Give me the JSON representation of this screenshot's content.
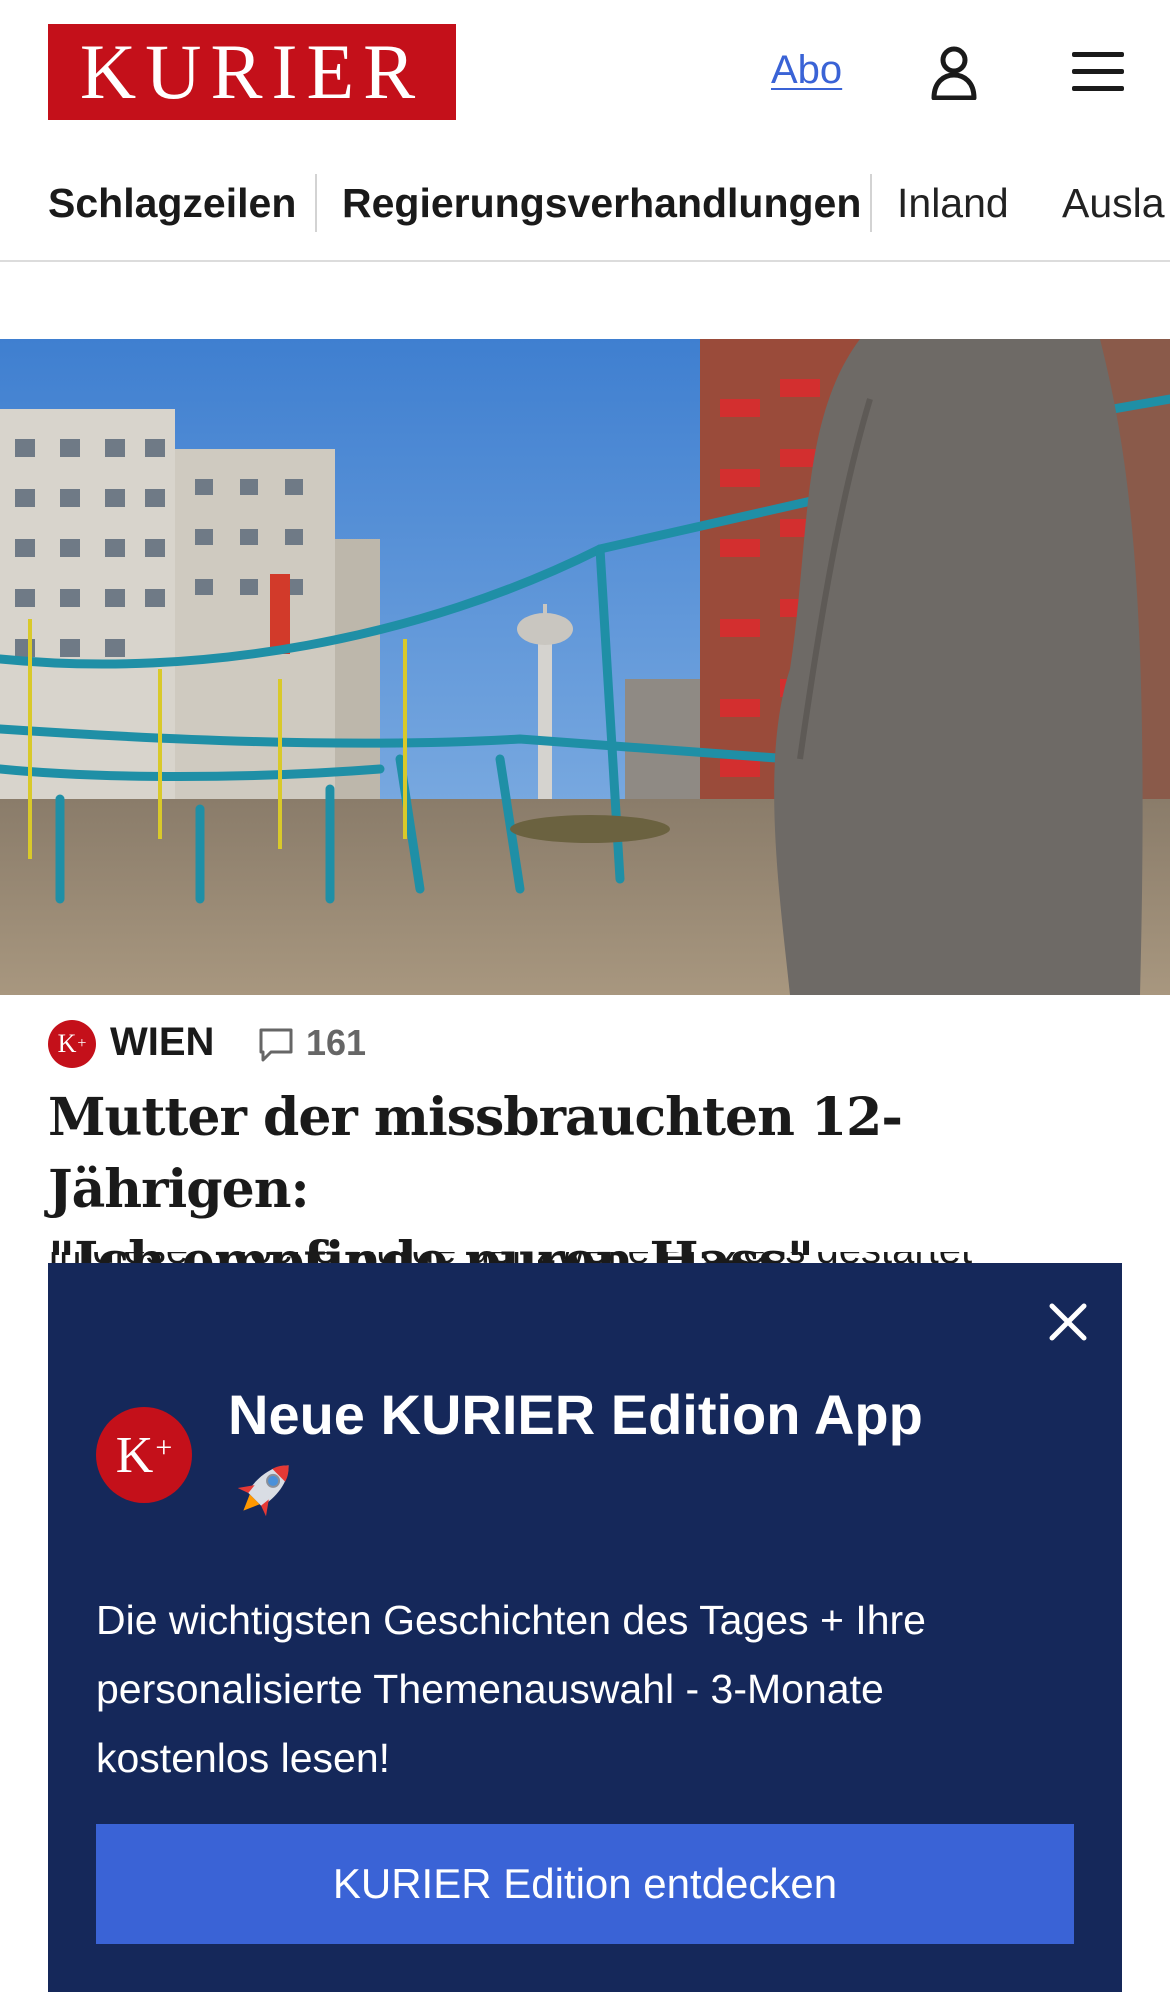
{
  "header": {
    "logo_text": "KURIER",
    "abo_label": "Abo",
    "user_icon": "user-icon",
    "menu_icon": "hamburger-menu-icon"
  },
  "nav": {
    "items": [
      {
        "label": "Schlagzeilen",
        "active": true
      },
      {
        "label": "Regierungsverhandlungen",
        "active": true
      },
      {
        "label": "Inland",
        "active": false
      },
      {
        "label": "Ausla",
        "active": false
      }
    ]
  },
  "article": {
    "premium_badge": "K+",
    "section": "WIEN",
    "comment_icon": "comment-icon",
    "comment_count": "161",
    "headline_line1": "Mutter der missbrauchten 12-Jährigen:",
    "headline_line2": "\"Ich empfinde puren Hass\"",
    "teaser_partial": "In dieser Woche wurde der zweite Prozess gestartet"
  },
  "popup": {
    "badge": "K+",
    "title": "Neue KURIER Edition App",
    "title_icon": "rocket-icon",
    "text": "Die wichtigsten Geschichten des Tages + Ihre personalisierte Themenauswahl - 3-Monate kostenlos lesen!",
    "cta_label": "KURIER Edition entdecken",
    "close_icon": "close-icon"
  },
  "colors": {
    "brand_red": "#c4101a",
    "link_blue": "#3a63d6",
    "popup_navy": "#15285a"
  }
}
